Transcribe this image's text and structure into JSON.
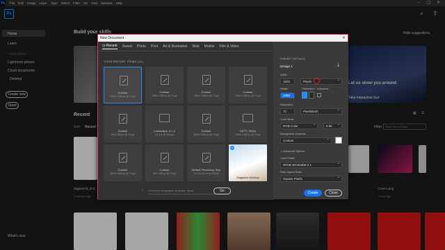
{
  "menubar": {
    "app_mark": "Ps",
    "items": [
      "File",
      "Edit",
      "Image",
      "Layer",
      "Type",
      "Select",
      "Filter",
      "3D",
      "View",
      "Window",
      "Help"
    ],
    "win_controls": [
      "–",
      "▢",
      "✕"
    ]
  },
  "appbar": {
    "logo": "Ps"
  },
  "sidebar": {
    "home": "Home",
    "learn": "Learn",
    "your_work_label": "YOUR WORK",
    "lightroom": "Lightroom photos",
    "cloud_docs": "Cloud documents",
    "deleted": "Deleted",
    "create_new": "Create new",
    "open": "Open",
    "whats_new": "What's new"
  },
  "home": {
    "build_skills": "Build your skills",
    "hide_suggestions": "Hide suggestions",
    "lets_show": "Let us show you around",
    "take_tour": "Take interactive tour",
    "recent": "Recent",
    "sort": "Sort",
    "sort_value": "Recent",
    "filter": "Filter",
    "filter_placeholder": "Filter Recent Files",
    "file1_name": "diggiworld_2nd_",
    "file1_time": "5 minutes ago",
    "file2_name": "Cover1.png",
    "file2_time": "1 hour ago"
  },
  "modal": {
    "title": "New Document",
    "tabs": [
      "Recent",
      "Saved",
      "Photo",
      "Print",
      "Art & Illustration",
      "Web",
      "Mobile",
      "Film & Video"
    ],
    "recent_label": "YOUR RECENT ITEMS (11)",
    "presets": [
      {
        "name": "Custom",
        "desc": "1920 x 1080 px @ 72 ppi",
        "icon": "brush-icon"
      },
      {
        "name": "Custom",
        "desc": "1080 x 1080 px @ 72 ppi",
        "icon": "brush-icon"
      },
      {
        "name": "Custom",
        "desc": "1080 x 1080 px @ 72 ppi",
        "icon": "brush-icon"
      },
      {
        "name": "Custom",
        "desc": "3240 x 1080 px @ 72 ppi",
        "icon": "brush-icon"
      },
      {
        "name": "Custom",
        "desc": "500 x 502 px @ 72 ppi",
        "icon": "brush-icon"
      },
      {
        "name": "Landscape, 6 x 4",
        "desc": "6 x 4 in @ 300 ppi",
        "icon": "image-icon"
      },
      {
        "name": "Custom",
        "desc": "3840 x 2160 px @ 72 ppi",
        "icon": "brush-icon"
      },
      {
        "name": "HDTV 1080p",
        "desc": "1920 x 1080 px @ 72 ppi",
        "icon": "video-icon"
      },
      {
        "name": "Custom",
        "desc": "3840 x 2160 px @ 72 ppi",
        "icon": "brush-icon"
      },
      {
        "name": "Custom",
        "desc": "500 x 500 px @ 72 ppi",
        "icon": "brush-icon"
      },
      {
        "name": "Default Photoshop Size",
        "desc": "16 x 21.01 cm @ 300 ppi",
        "icon": "brush-icon"
      },
      {
        "name": "Magazine Mockup",
        "desc": "",
        "icon": "magazine-thumbnail"
      }
    ],
    "search_placeholder": "Find more templates on Adobe Stock",
    "go": "Go",
    "details": {
      "preset_details_label": "PRESET DETAILS",
      "doc_name": "Design 1",
      "width_label": "Width",
      "width_value": "1920",
      "width_unit": "Pixels",
      "height_label": "Height",
      "height_value": "1080",
      "orientation_label": "Orientation",
      "artboards_label": "Artboards",
      "resolution_label": "Resolution",
      "resolution_value": "72",
      "resolution_unit": "Pixels/Inch",
      "color_mode_label": "Color Mode",
      "color_mode_value": "RGB Color",
      "bit_depth_value": "8 bit",
      "bg_contents_label": "Background Contents",
      "bg_contents_value": "Custom",
      "advanced_label": "Advanced Options",
      "color_profile_label": "Color Profile",
      "color_profile_value": "sRGB IEC61966-2.1",
      "pixel_aspect_label": "Pixel Aspect Ratio",
      "pixel_aspect_value": "Square Pixels",
      "create": "Create",
      "close": "Close"
    }
  },
  "colors": {
    "accent_blue": "#1473e6",
    "select_blue": "#2d8ceb",
    "ps_blue": "#31a8ff",
    "modal_border": "#e9356d"
  }
}
